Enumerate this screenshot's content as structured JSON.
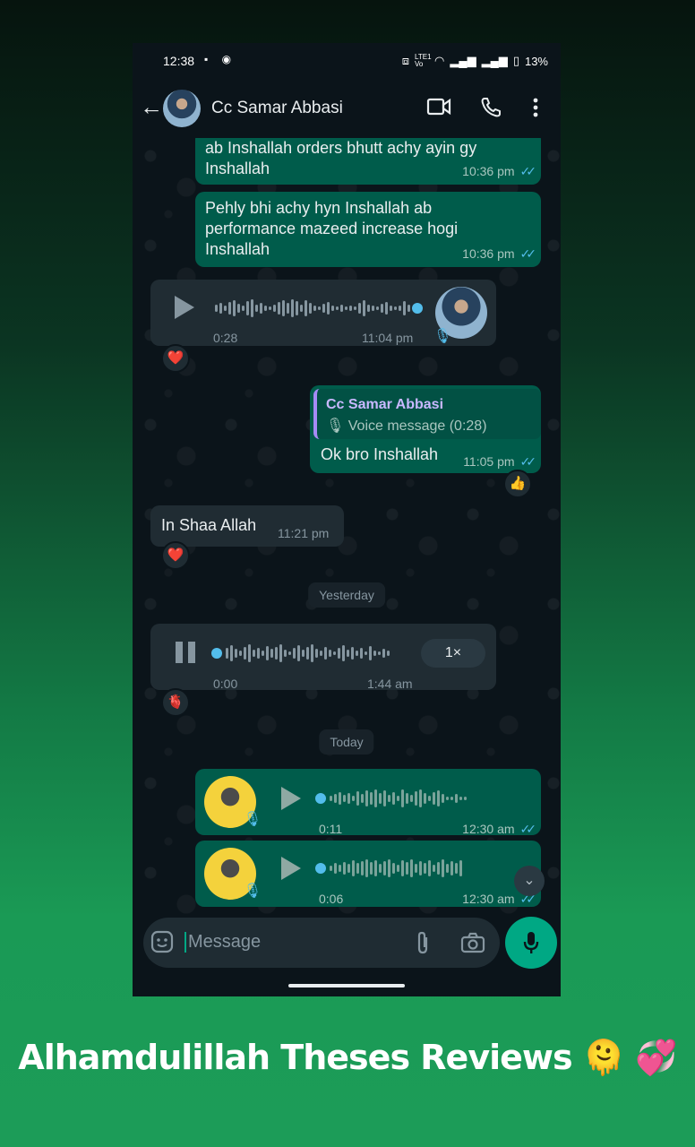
{
  "status": {
    "time": "12:38",
    "battery": "13%",
    "network": "LTE1 Vo"
  },
  "header": {
    "contact_name": "Cc Samar Abbasi"
  },
  "messages": {
    "m1": {
      "text": "ab Inshallah orders bhutt achy ayin gy Inshallah",
      "time": "10:36 pm"
    },
    "m2": {
      "text": "Pehly bhi achy hyn Inshallah ab performance mazeed increase hogi Inshallah",
      "time": "10:36 pm"
    },
    "vm1": {
      "duration": "0:28",
      "time": "11:04 pm",
      "reaction": "❤️"
    },
    "reply": {
      "quoted_name": "Cc Samar Abbasi",
      "quoted_text": "Voice message (0:28)",
      "text": "Ok bro Inshallah",
      "time": "11:05 pm",
      "reaction": "👍"
    },
    "in1": {
      "text": "In Shaa Allah",
      "time": "11:21 pm",
      "reaction": "❤️"
    },
    "date1": "Yesterday",
    "vm2": {
      "duration": "0:00",
      "time": "1:44 am",
      "speed": "1×",
      "reaction": "🫀"
    },
    "date2": "Today",
    "vm3": {
      "duration": "0:11",
      "time": "12:30 am"
    },
    "vm4": {
      "duration": "0:06",
      "time": "12:30 am"
    }
  },
  "composer": {
    "placeholder": "Message"
  },
  "caption": "Alhamdulillah Theses Reviews 🫠 💞"
}
